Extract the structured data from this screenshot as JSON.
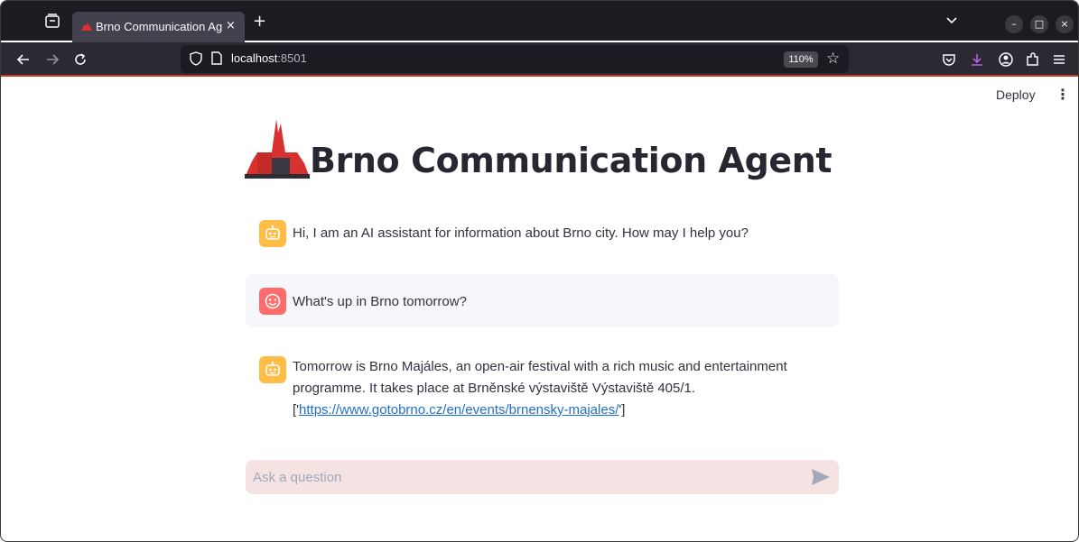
{
  "browser": {
    "tab_title": "Brno Communication Agent",
    "tab_close": "×",
    "new_tab": "+",
    "url_host": "localhost",
    "url_port": ":8501",
    "zoom": "110%",
    "window_controls": {
      "minimize": "–",
      "maximize": "□",
      "close": "×"
    },
    "icons": [
      "tab-overview-icon",
      "back-icon",
      "forward-icon",
      "reload-icon",
      "shield-icon",
      "page-icon",
      "star-icon",
      "pocket-icon",
      "download-icon",
      "account-icon",
      "extensions-icon",
      "menu-icon"
    ]
  },
  "app": {
    "deploy_label": "Deploy",
    "menu_glyph": "⋮",
    "title": "Brno Communication Agent",
    "logo_icon": "brno-cathedral-icon",
    "brand_color": "#d8312f"
  },
  "messages": [
    {
      "role": "assistant",
      "avatar_icon": "robot-icon",
      "text": "Hi, I am an AI assistant for information about Brno city. How may I help you?"
    },
    {
      "role": "user",
      "avatar_icon": "smiley-icon",
      "text": "What's up in Brno tomorrow?"
    },
    {
      "role": "assistant",
      "avatar_icon": "robot-icon",
      "text_before": "Tomorrow is Brno Majáles, an open-air festival with a rich music and entertainment programme. It takes place at Brněnské výstaviště Výstaviště 405/1. ['",
      "link": "https://www.gotobrno.cz/en/events/brnensky-majales/",
      "text_after": "']"
    }
  ],
  "chat_input": {
    "placeholder": "Ask a question",
    "value": "",
    "send_icon": "send-icon"
  }
}
